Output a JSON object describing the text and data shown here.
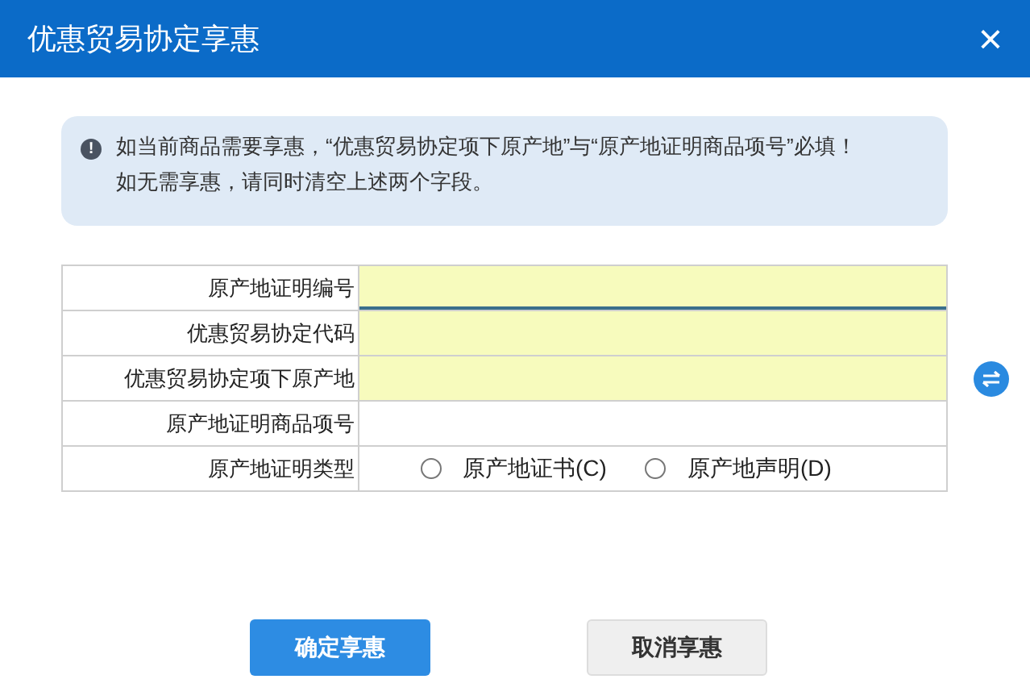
{
  "window": {
    "title": "优惠贸易协定享惠",
    "close": "×"
  },
  "alert": {
    "icon": "!",
    "lines": [
      "如当前商品需要享惠，“优惠贸易协定项下原产地”与“原产地证明商品项号”必填！",
      "如无需享惠，请同时清空上述两个字段。"
    ]
  },
  "fields": [
    {
      "label": "原产地证明编号",
      "kind": "text",
      "required": true,
      "focused": true
    },
    {
      "label": "优惠贸易协定代码",
      "kind": "text",
      "required": true,
      "focused": false
    },
    {
      "label": "优惠贸易协定项下原产地",
      "kind": "text",
      "required": true,
      "focused": false
    },
    {
      "label": "原产地证明商品项号",
      "kind": "text",
      "required": false,
      "focused": false
    },
    {
      "label": "原产地证明类型",
      "kind": "radio",
      "options": [
        {
          "label": "原产地证书(C)",
          "selected": false
        },
        {
          "label": "原产地声明(D)",
          "selected": false
        }
      ]
    }
  ],
  "buttons": [
    {
      "label": "确定享惠",
      "kind": "primary"
    },
    {
      "label": "取消享惠",
      "kind": "secondary"
    }
  ]
}
